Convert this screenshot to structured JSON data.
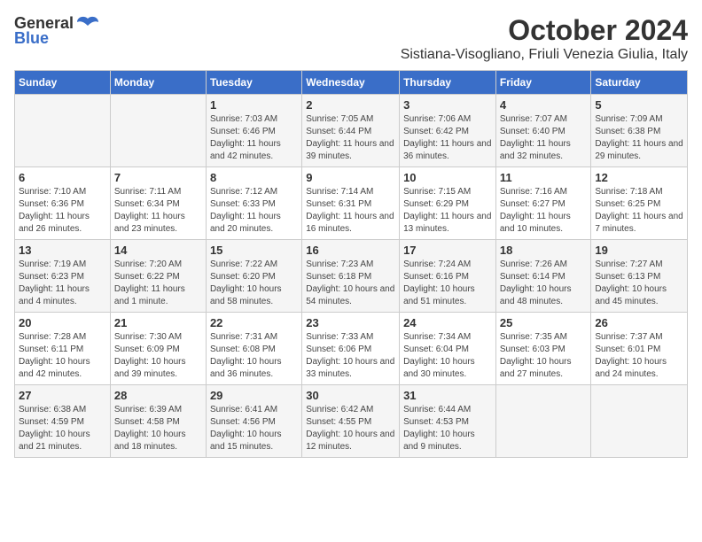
{
  "logo": {
    "general": "General",
    "blue": "Blue"
  },
  "title": "October 2024",
  "location": "Sistiana-Visogliano, Friuli Venezia Giulia, Italy",
  "days_of_week": [
    "Sunday",
    "Monday",
    "Tuesday",
    "Wednesday",
    "Thursday",
    "Friday",
    "Saturday"
  ],
  "weeks": [
    [
      {
        "day": null
      },
      {
        "day": null
      },
      {
        "day": 1,
        "sunrise": "7:03 AM",
        "sunset": "6:46 PM",
        "daylight": "11 hours and 42 minutes."
      },
      {
        "day": 2,
        "sunrise": "7:05 AM",
        "sunset": "6:44 PM",
        "daylight": "11 hours and 39 minutes."
      },
      {
        "day": 3,
        "sunrise": "7:06 AM",
        "sunset": "6:42 PM",
        "daylight": "11 hours and 36 minutes."
      },
      {
        "day": 4,
        "sunrise": "7:07 AM",
        "sunset": "6:40 PM",
        "daylight": "11 hours and 32 minutes."
      },
      {
        "day": 5,
        "sunrise": "7:09 AM",
        "sunset": "6:38 PM",
        "daylight": "11 hours and 29 minutes."
      }
    ],
    [
      {
        "day": 6,
        "sunrise": "7:10 AM",
        "sunset": "6:36 PM",
        "daylight": "11 hours and 26 minutes."
      },
      {
        "day": 7,
        "sunrise": "7:11 AM",
        "sunset": "6:34 PM",
        "daylight": "11 hours and 23 minutes."
      },
      {
        "day": 8,
        "sunrise": "7:12 AM",
        "sunset": "6:33 PM",
        "daylight": "11 hours and 20 minutes."
      },
      {
        "day": 9,
        "sunrise": "7:14 AM",
        "sunset": "6:31 PM",
        "daylight": "11 hours and 16 minutes."
      },
      {
        "day": 10,
        "sunrise": "7:15 AM",
        "sunset": "6:29 PM",
        "daylight": "11 hours and 13 minutes."
      },
      {
        "day": 11,
        "sunrise": "7:16 AM",
        "sunset": "6:27 PM",
        "daylight": "11 hours and 10 minutes."
      },
      {
        "day": 12,
        "sunrise": "7:18 AM",
        "sunset": "6:25 PM",
        "daylight": "11 hours and 7 minutes."
      }
    ],
    [
      {
        "day": 13,
        "sunrise": "7:19 AM",
        "sunset": "6:23 PM",
        "daylight": "11 hours and 4 minutes."
      },
      {
        "day": 14,
        "sunrise": "7:20 AM",
        "sunset": "6:22 PM",
        "daylight": "11 hours and 1 minute."
      },
      {
        "day": 15,
        "sunrise": "7:22 AM",
        "sunset": "6:20 PM",
        "daylight": "10 hours and 58 minutes."
      },
      {
        "day": 16,
        "sunrise": "7:23 AM",
        "sunset": "6:18 PM",
        "daylight": "10 hours and 54 minutes."
      },
      {
        "day": 17,
        "sunrise": "7:24 AM",
        "sunset": "6:16 PM",
        "daylight": "10 hours and 51 minutes."
      },
      {
        "day": 18,
        "sunrise": "7:26 AM",
        "sunset": "6:14 PM",
        "daylight": "10 hours and 48 minutes."
      },
      {
        "day": 19,
        "sunrise": "7:27 AM",
        "sunset": "6:13 PM",
        "daylight": "10 hours and 45 minutes."
      }
    ],
    [
      {
        "day": 20,
        "sunrise": "7:28 AM",
        "sunset": "6:11 PM",
        "daylight": "10 hours and 42 minutes."
      },
      {
        "day": 21,
        "sunrise": "7:30 AM",
        "sunset": "6:09 PM",
        "daylight": "10 hours and 39 minutes."
      },
      {
        "day": 22,
        "sunrise": "7:31 AM",
        "sunset": "6:08 PM",
        "daylight": "10 hours and 36 minutes."
      },
      {
        "day": 23,
        "sunrise": "7:33 AM",
        "sunset": "6:06 PM",
        "daylight": "10 hours and 33 minutes."
      },
      {
        "day": 24,
        "sunrise": "7:34 AM",
        "sunset": "6:04 PM",
        "daylight": "10 hours and 30 minutes."
      },
      {
        "day": 25,
        "sunrise": "7:35 AM",
        "sunset": "6:03 PM",
        "daylight": "10 hours and 27 minutes."
      },
      {
        "day": 26,
        "sunrise": "7:37 AM",
        "sunset": "6:01 PM",
        "daylight": "10 hours and 24 minutes."
      }
    ],
    [
      {
        "day": 27,
        "sunrise": "6:38 AM",
        "sunset": "4:59 PM",
        "daylight": "10 hours and 21 minutes."
      },
      {
        "day": 28,
        "sunrise": "6:39 AM",
        "sunset": "4:58 PM",
        "daylight": "10 hours and 18 minutes."
      },
      {
        "day": 29,
        "sunrise": "6:41 AM",
        "sunset": "4:56 PM",
        "daylight": "10 hours and 15 minutes."
      },
      {
        "day": 30,
        "sunrise": "6:42 AM",
        "sunset": "4:55 PM",
        "daylight": "10 hours and 12 minutes."
      },
      {
        "day": 31,
        "sunrise": "6:44 AM",
        "sunset": "4:53 PM",
        "daylight": "10 hours and 9 minutes."
      },
      {
        "day": null
      },
      {
        "day": null
      }
    ]
  ]
}
